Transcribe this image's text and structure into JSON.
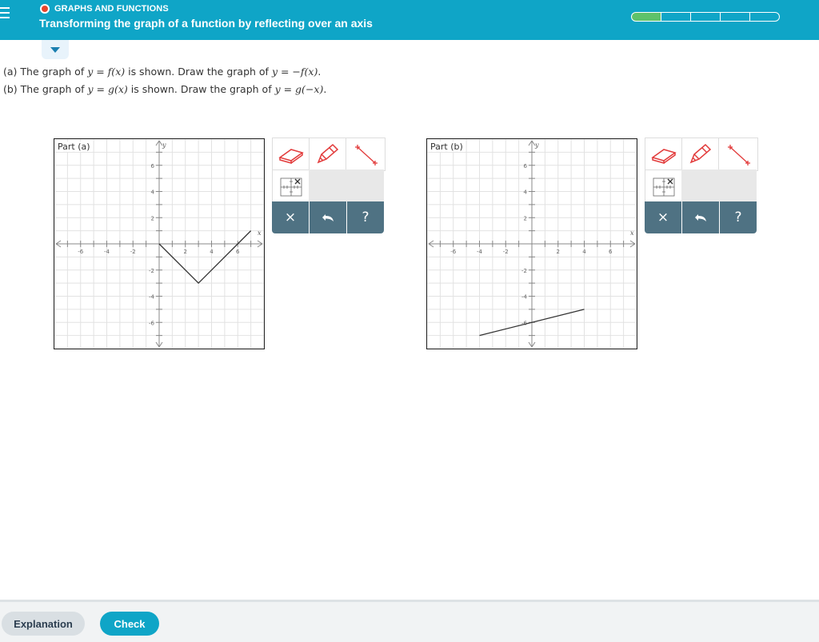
{
  "header": {
    "topic": "GRAPHS AND FUNCTIONS",
    "title": "Transforming the graph of a function by reflecting over an axis",
    "progress": {
      "segments": 5,
      "completed": 1
    }
  },
  "questions": [
    {
      "prefix": "(a) The graph of ",
      "given": "y = f(x)",
      "mid": " is shown. Draw the graph of ",
      "target": "y = −f(x)",
      "suffix": "."
    },
    {
      "prefix": "(b) The graph of ",
      "given": "y = g(x)",
      "mid": " is shown. Draw the graph of ",
      "target": "y = g(−x)",
      "suffix": "."
    }
  ],
  "graphs": [
    {
      "label": "Part (a)",
      "x_axis_label": "x",
      "y_axis_label": "y",
      "x_ticks": [
        "-6",
        "-4",
        "-2",
        "2",
        "4",
        "6"
      ],
      "y_ticks": [
        "6",
        "4",
        "2",
        "-2",
        "-4",
        "-6"
      ],
      "xlim": [
        -8,
        8
      ],
      "ylim": [
        -8,
        8
      ],
      "line_points": [
        [
          0,
          0
        ],
        [
          3,
          -3
        ],
        [
          7,
          1
        ]
      ]
    },
    {
      "label": "Part (b)",
      "x_axis_label": "x",
      "y_axis_label": "y",
      "x_ticks": [
        "-6",
        "-4",
        "-2",
        "2",
        "4",
        "6"
      ],
      "y_ticks": [
        "6",
        "4",
        "2",
        "-2",
        "-4",
        "-6"
      ],
      "xlim": [
        -8,
        8
      ],
      "ylim": [
        -8,
        8
      ],
      "line_points": [
        [
          -4,
          -7
        ],
        [
          4,
          -5
        ]
      ]
    }
  ],
  "tools": {
    "eraser_icon": "eraser-icon",
    "pencil_icon": "pencil-icon",
    "segment_icon": "line-segment-icon",
    "grid_icon": "graph-delete-icon",
    "clear_label": "×",
    "undo_icon": "undo-icon",
    "help_label": "?"
  },
  "footer": {
    "explanation_label": "Explanation",
    "check_label": "Check"
  },
  "colors": {
    "header": "#0fa5c7",
    "progress_done": "#5ec26a",
    "tool_bar": "#4f7283",
    "tool_red": "#e23b3b"
  }
}
